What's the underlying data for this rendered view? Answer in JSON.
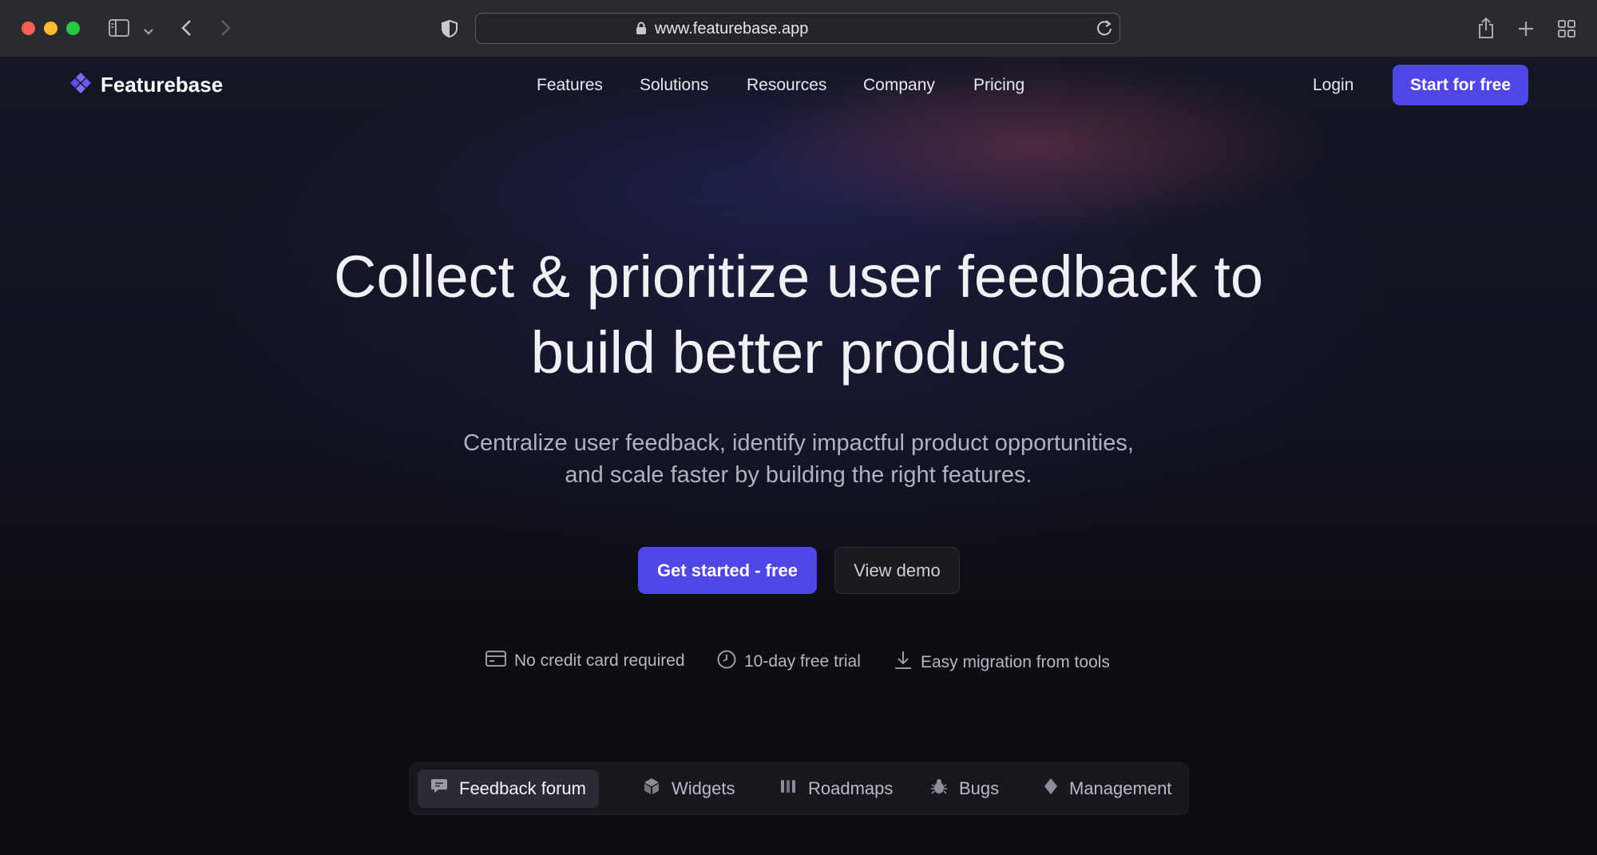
{
  "browser": {
    "url": "www.featurebase.app"
  },
  "site": {
    "brand": "Featurebase",
    "nav": [
      "Features",
      "Solutions",
      "Resources",
      "Company",
      "Pricing"
    ],
    "login": "Login",
    "start_cta": "Start for free"
  },
  "hero": {
    "title_line1": "Collect & prioritize user feedback to",
    "title_line2": "build better products",
    "subtitle_line1": "Centralize user feedback, identify impactful product opportunities,",
    "subtitle_line2": "and scale faster by building the right features.",
    "primary_cta": "Get started - free",
    "secondary_cta": "View demo",
    "perks": [
      {
        "icon": "credit-card-icon",
        "label": "No credit card required"
      },
      {
        "icon": "clock-icon",
        "label": "10-day free trial"
      },
      {
        "icon": "download-icon",
        "label": "Easy migration from tools"
      }
    ]
  },
  "product_tabs": [
    {
      "icon": "chat-bubble-icon",
      "label": "Feedback forum",
      "active": true
    },
    {
      "icon": "cube-icon",
      "label": "Widgets",
      "active": false
    },
    {
      "icon": "roadmap-icon",
      "label": "Roadmaps",
      "active": false
    },
    {
      "icon": "bug-icon",
      "label": "Bugs",
      "active": false
    },
    {
      "icon": "diamond-icon",
      "label": "Management",
      "active": false
    }
  ],
  "colors": {
    "accent": "#4f46e5",
    "background": "#0f0f14",
    "chrome": "#2a2b2e"
  }
}
